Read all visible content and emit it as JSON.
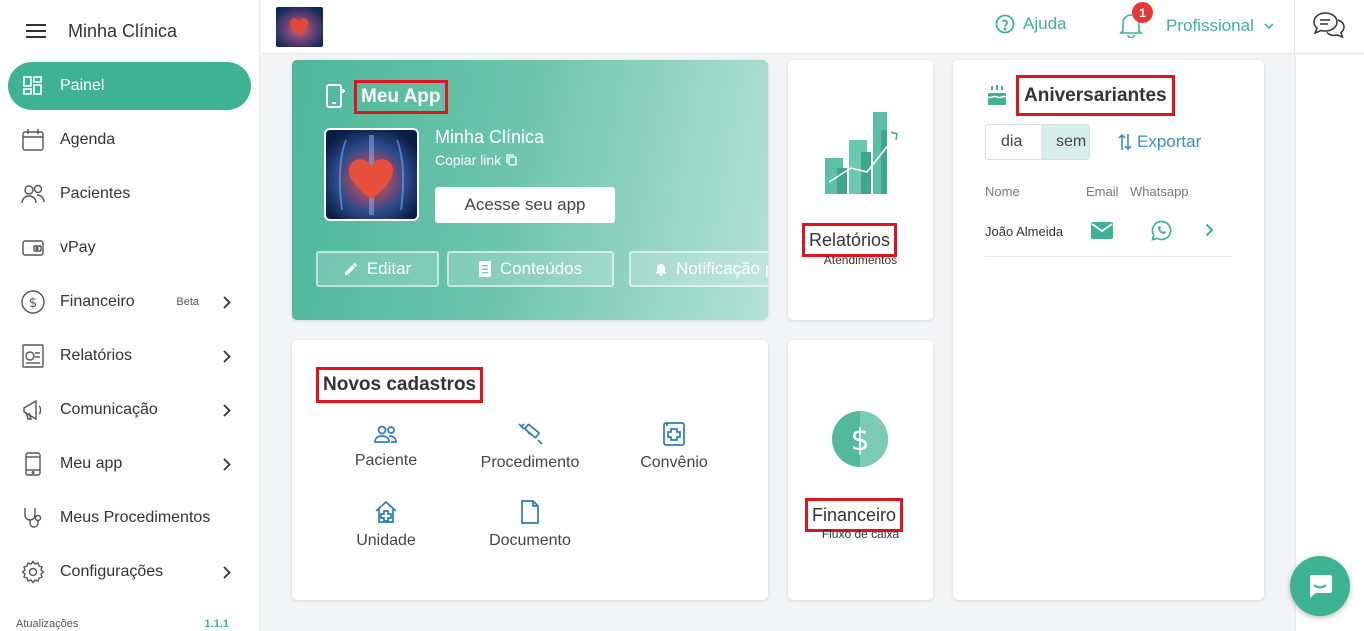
{
  "sidebar": {
    "brand": "Minha Clínica",
    "items": [
      {
        "label": "Painel",
        "icon": "dashboard-icon",
        "active": true
      },
      {
        "label": "Agenda",
        "icon": "calendar-icon"
      },
      {
        "label": "Pacientes",
        "icon": "users-icon"
      },
      {
        "label": "vPay",
        "icon": "wallet-icon"
      },
      {
        "label": "Financeiro",
        "icon": "dollar-circle-icon",
        "badge": "Beta",
        "chevron": true
      },
      {
        "label": "Relatórios",
        "icon": "report-icon",
        "chevron": true
      },
      {
        "label": "Comunicação",
        "icon": "megaphone-icon",
        "chevron": true
      },
      {
        "label": "Meu app",
        "icon": "phone-icon",
        "chevron": true
      },
      {
        "label": "Meus Procedimentos",
        "icon": "stethoscope-icon"
      },
      {
        "label": "Configurações",
        "icon": "gear-icon",
        "chevron": true
      }
    ],
    "footer": {
      "label": "Atualizações",
      "version": "1.1.1"
    }
  },
  "topbar": {
    "help": "Ajuda",
    "notifications": "1",
    "profile": "Profissional"
  },
  "app_card": {
    "title": "Meu App",
    "clinic_name": "Minha Clínica",
    "copy_link": "Copiar link",
    "access": "Acesse seu app",
    "edit": "Editar",
    "contents": "Conteúdos",
    "notification": "Notificação p"
  },
  "reports_card": {
    "title": "Relatórios",
    "subtitle": "Atendimentos"
  },
  "finance_card": {
    "title": "Financeiro",
    "subtitle": "Fluxo de caixa"
  },
  "new_card": {
    "title": "Novos cadastros",
    "items": [
      "Paciente",
      "Procedimento",
      "Convênio",
      "Unidade",
      "Documento"
    ]
  },
  "birthdays": {
    "title": "Aniversariantes",
    "seg_day": "dia",
    "seg_week": "sem",
    "export": "Exportar",
    "columns": [
      "Nome",
      "Email",
      "Whatsapp"
    ],
    "rows": [
      {
        "name": "João Almeida"
      }
    ]
  },
  "colors": {
    "accent": "#3db394",
    "highlight": "#e0141e",
    "link": "#3b8fc9",
    "badge": "#e53935"
  }
}
